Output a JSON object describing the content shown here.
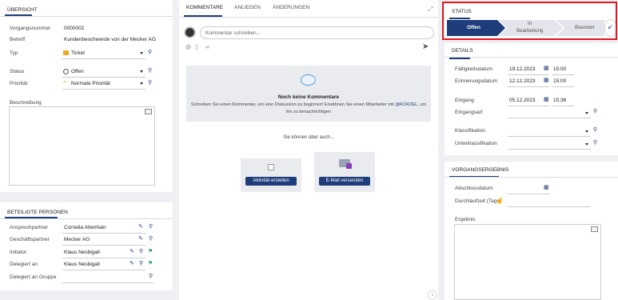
{
  "left": {
    "overview_title": "Übersicht",
    "fields": [
      {
        "label": "Vorgangsnummer",
        "value": "0000002"
      },
      {
        "label": "Betreff",
        "value": "Kundenbeschwerde von der Mecker AG"
      },
      {
        "label": "Typ",
        "value": "Ticket"
      },
      {
        "label": "Status",
        "value": "Offen"
      },
      {
        "label": "Priorität",
        "value": "Normale Priorität"
      }
    ],
    "description_label": "Beschreibung",
    "persons_title": "Beteiligte Personen",
    "persons": [
      {
        "label": "Ansprechpartner",
        "value": "Cornelia Altenhain"
      },
      {
        "label": "Geschäftspartner",
        "value": "Mecker AG"
      },
      {
        "label": "Initiator",
        "value": "Klaus Nesbigall"
      },
      {
        "label": "Delegiert an",
        "value": "Klaus Nesbigall"
      },
      {
        "label": "Delegiert an Gruppe",
        "value": ""
      }
    ]
  },
  "middle": {
    "tabs": [
      "Kommentare",
      "Anliegen",
      "Änderungen"
    ],
    "comment_placeholder": "Kommentar schreiben...",
    "empty_title": "Noch keine Kommentare",
    "empty_text_1": "Schreiben Sie einen Kommentar, um eine Diskussion zu beginnen! Erwähnen Sie einen Mitarbeiter mit",
    "empty_mention": "@KÜRZEL",
    "empty_text_2": ", um",
    "empty_text_3": "ihn zu benachrichtigen",
    "also_text": "Sie können aber auch...",
    "action_activity": "Aktivität erstellen",
    "action_email": "E-Mail versenden"
  },
  "right": {
    "status_title": "Status",
    "steps": [
      "Offen",
      "In Bearbeitung",
      "Beendet"
    ],
    "steps_display": {
      "step2_line1": "In",
      "step2_line2": "Bearbeitung"
    },
    "details_title": "Details",
    "details": [
      {
        "label": "Fälligkeitsdatum",
        "date": "19.12.2023",
        "time": "15:00"
      },
      {
        "label": "Erinnerungsdatum",
        "date": "12.12.2023",
        "time": "15:00"
      },
      {
        "label": "Eingang",
        "date": "05.12.2023",
        "time": "15:36"
      }
    ],
    "eingangsart_label": "Eingangsart",
    "klassifikation_label": "Klassifikation",
    "unterklassifikation_label": "Unterklassifikation",
    "result_title": "Vorgangsergebnis",
    "abschluss_label": "Abschlussdatum",
    "durchlaufzeit_label": "Durchlaufzeit (Tage)",
    "ergebnis_label": "Ergebnis"
  },
  "colors": {
    "accent": "#1f3d7a",
    "highlight": "#e8141c",
    "step_inactive": "#e3e5ea"
  }
}
